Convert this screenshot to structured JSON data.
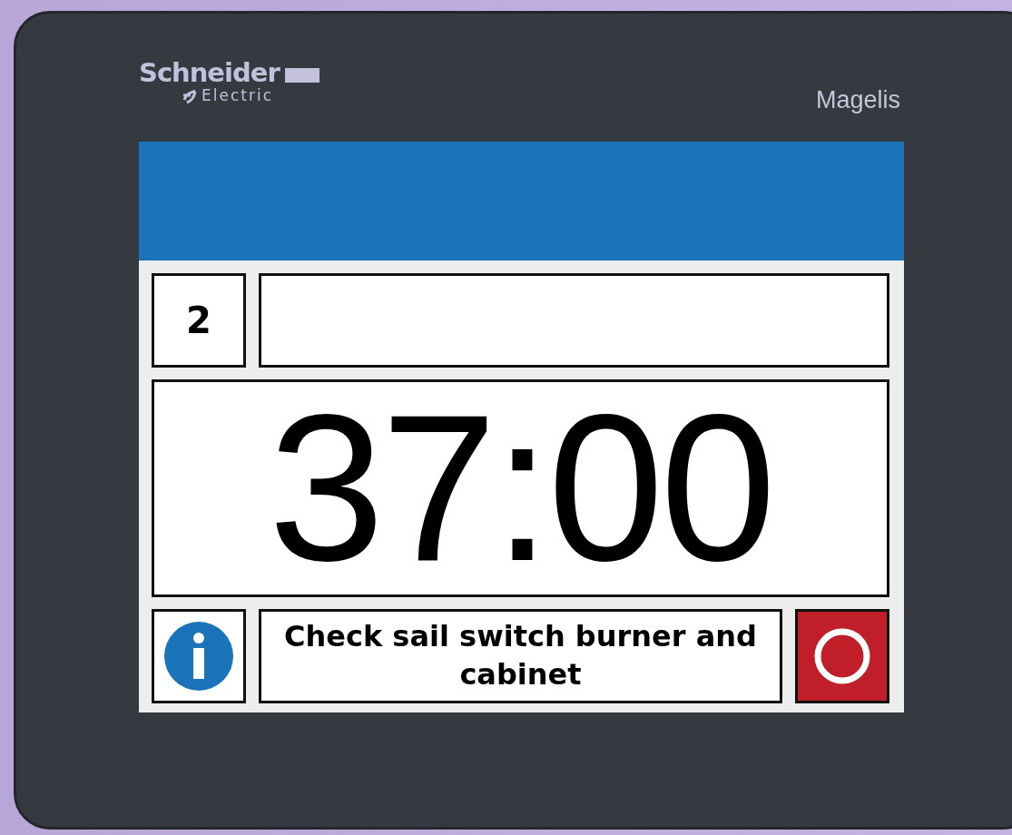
{
  "device": {
    "brand": "Schneider",
    "brand_sub": "Electric",
    "model": "Magelis"
  },
  "screen": {
    "step_number": "2",
    "timer": "37:00",
    "message": "Check sail switch burner and cabinet"
  }
}
